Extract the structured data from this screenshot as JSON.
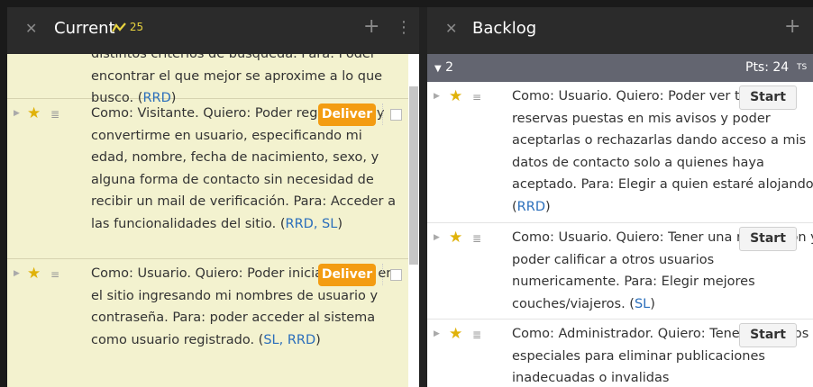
{
  "current": {
    "title": "Current",
    "velocity": "25",
    "stories": [
      {
        "text": "distintos criterios de busqueda. Para: Poder encontrar el que mejor se aproxime a lo que busco. ",
        "labels": "RRD",
        "partial": true
      },
      {
        "text": "Como: Visitante. Quiero: Poder registrarme y convertirme en usuario, especificando mi edad, nombre, fecha de nacimiento, sexo, y alguna forma de contacto sin necesidad de recibir un mail de verificación. Para: Acceder a las funcionalidades del sitio. ",
        "labels": "RRD, SL",
        "button": "Deliver"
      },
      {
        "text": "Como: Usuario. Quiero: Poder iniciar sesion en el sitio ingresando mi nombres de usuario y contraseña. Para: poder acceder al sistema como usuario registrado. ",
        "labels": "SL, RRD",
        "button": "Deliver"
      }
    ]
  },
  "backlog": {
    "title": "Backlog",
    "iteration": {
      "number": "2",
      "points": "Pts: 24",
      "ts": "TS"
    },
    "stories": [
      {
        "text": "Como: Usuario. Quiero: Poder ver todas las reservas puestas en mis avisos y poder aceptarlas o rechazarlas dando acceso a mis datos de contacto solo a quienes haya aceptado. Para: Elegir a quien estaré alojando. ",
        "labels": "RRD",
        "button": "Start"
      },
      {
        "text": "Como: Usuario. Quiero: Tener una reputacion y poder calificar a otros usuarios numericamente. Para: Elegir mejores couches/viajeros. ",
        "labels": "SL",
        "button": "Start"
      },
      {
        "text": "Como: Administrador. Quiero: Tener permisos especiales para eliminar publicaciones inadecuadas o invalidas",
        "labels": "",
        "button": "Start"
      }
    ]
  },
  "icons": {
    "close": "close-icon",
    "add": "plus-icon",
    "menu": "kebab-menu-icon",
    "star": "star-icon",
    "expand": "caret-right-icon"
  }
}
